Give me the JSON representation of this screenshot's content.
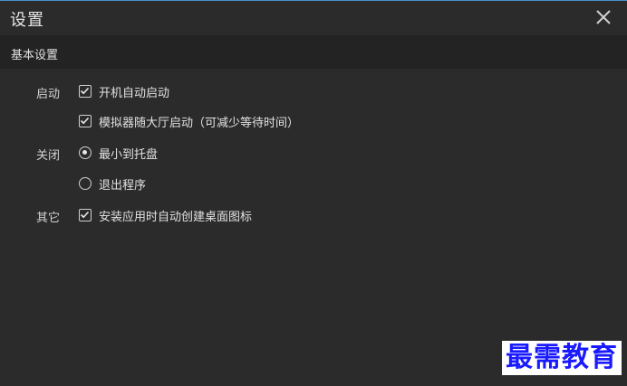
{
  "window": {
    "title": "设置"
  },
  "section": {
    "title": "基本设置"
  },
  "startup": {
    "label": "启动",
    "options": [
      {
        "text": "开机自动启动",
        "checked": true
      },
      {
        "text": "模拟器随大厅启动（可减少等待时间）",
        "checked": true
      }
    ]
  },
  "close": {
    "label": "关闭",
    "options": [
      {
        "text": "最小到托盘",
        "selected": true
      },
      {
        "text": "退出程序",
        "selected": false
      }
    ]
  },
  "other": {
    "label": "其它",
    "options": [
      {
        "text": "安装应用时自动创建桌面图标",
        "checked": true
      }
    ]
  },
  "watermark": {
    "text": "最需教育"
  },
  "colors": {
    "background": "#2b2b2b",
    "header_band": "#232323",
    "accent_border": "#4a90c8"
  },
  "icons": {
    "close": "close-icon",
    "check": "checkmark-icon"
  }
}
